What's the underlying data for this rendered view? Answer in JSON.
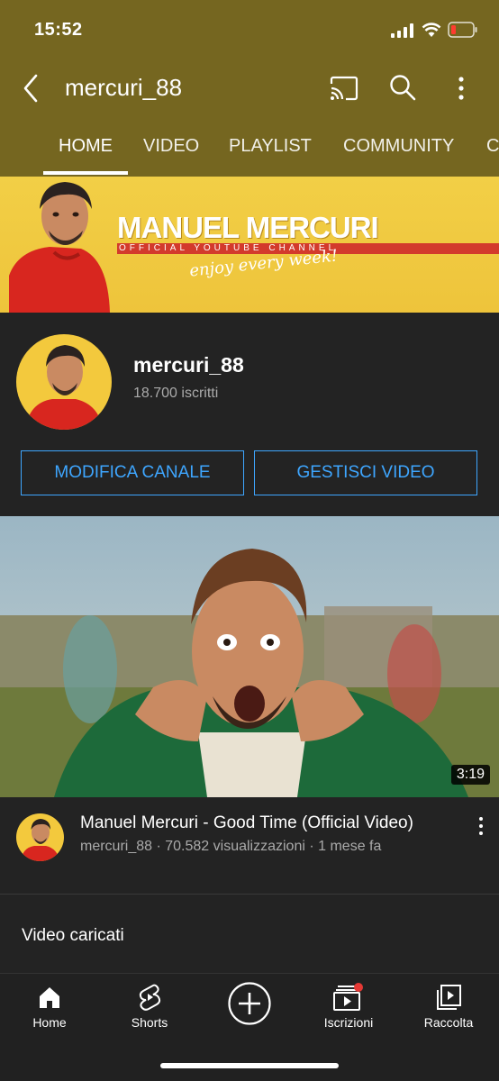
{
  "status_bar": {
    "time": "15:52"
  },
  "header": {
    "channel_name": "mercuri_88",
    "tabs": [
      {
        "label": "HOME",
        "active": true
      },
      {
        "label": "VIDEO",
        "active": false
      },
      {
        "label": "PLAYLIST",
        "active": false
      },
      {
        "label": "COMMUNITY",
        "active": false
      },
      {
        "label": "C",
        "active": false
      }
    ]
  },
  "banner": {
    "name": "MANUEL MERCURI",
    "subtitle": "OFFICIAL YOUTUBE CHANNEL",
    "tagline": "enjoy every week!"
  },
  "channel": {
    "handle": "mercuri_88",
    "subscribers": "18.700 iscritti"
  },
  "actions": {
    "edit_channel": "MODIFICA CANALE",
    "manage_videos": "GESTISCI VIDEO"
  },
  "featured_video": {
    "duration": "3:19",
    "title": "Manuel Mercuri - Good Time (Official Video)",
    "meta": "mercuri_88 · 70.582 visualizzazioni · 1 mese fa"
  },
  "section": {
    "label": "Video caricati"
  },
  "bottom_nav": [
    {
      "label": "Home",
      "icon": "home-icon"
    },
    {
      "label": "Shorts",
      "icon": "shorts-icon"
    },
    {
      "label": "",
      "icon": "create-icon"
    },
    {
      "label": "Iscrizioni",
      "icon": "subscriptions-icon"
    },
    {
      "label": "Raccolta",
      "icon": "library-icon"
    }
  ],
  "colors": {
    "header_bg": "#756620",
    "background": "#232323",
    "accent_blue": "#3ea6ff",
    "banner_yellow": "#f2cf46",
    "badge_red": "#e53935"
  }
}
